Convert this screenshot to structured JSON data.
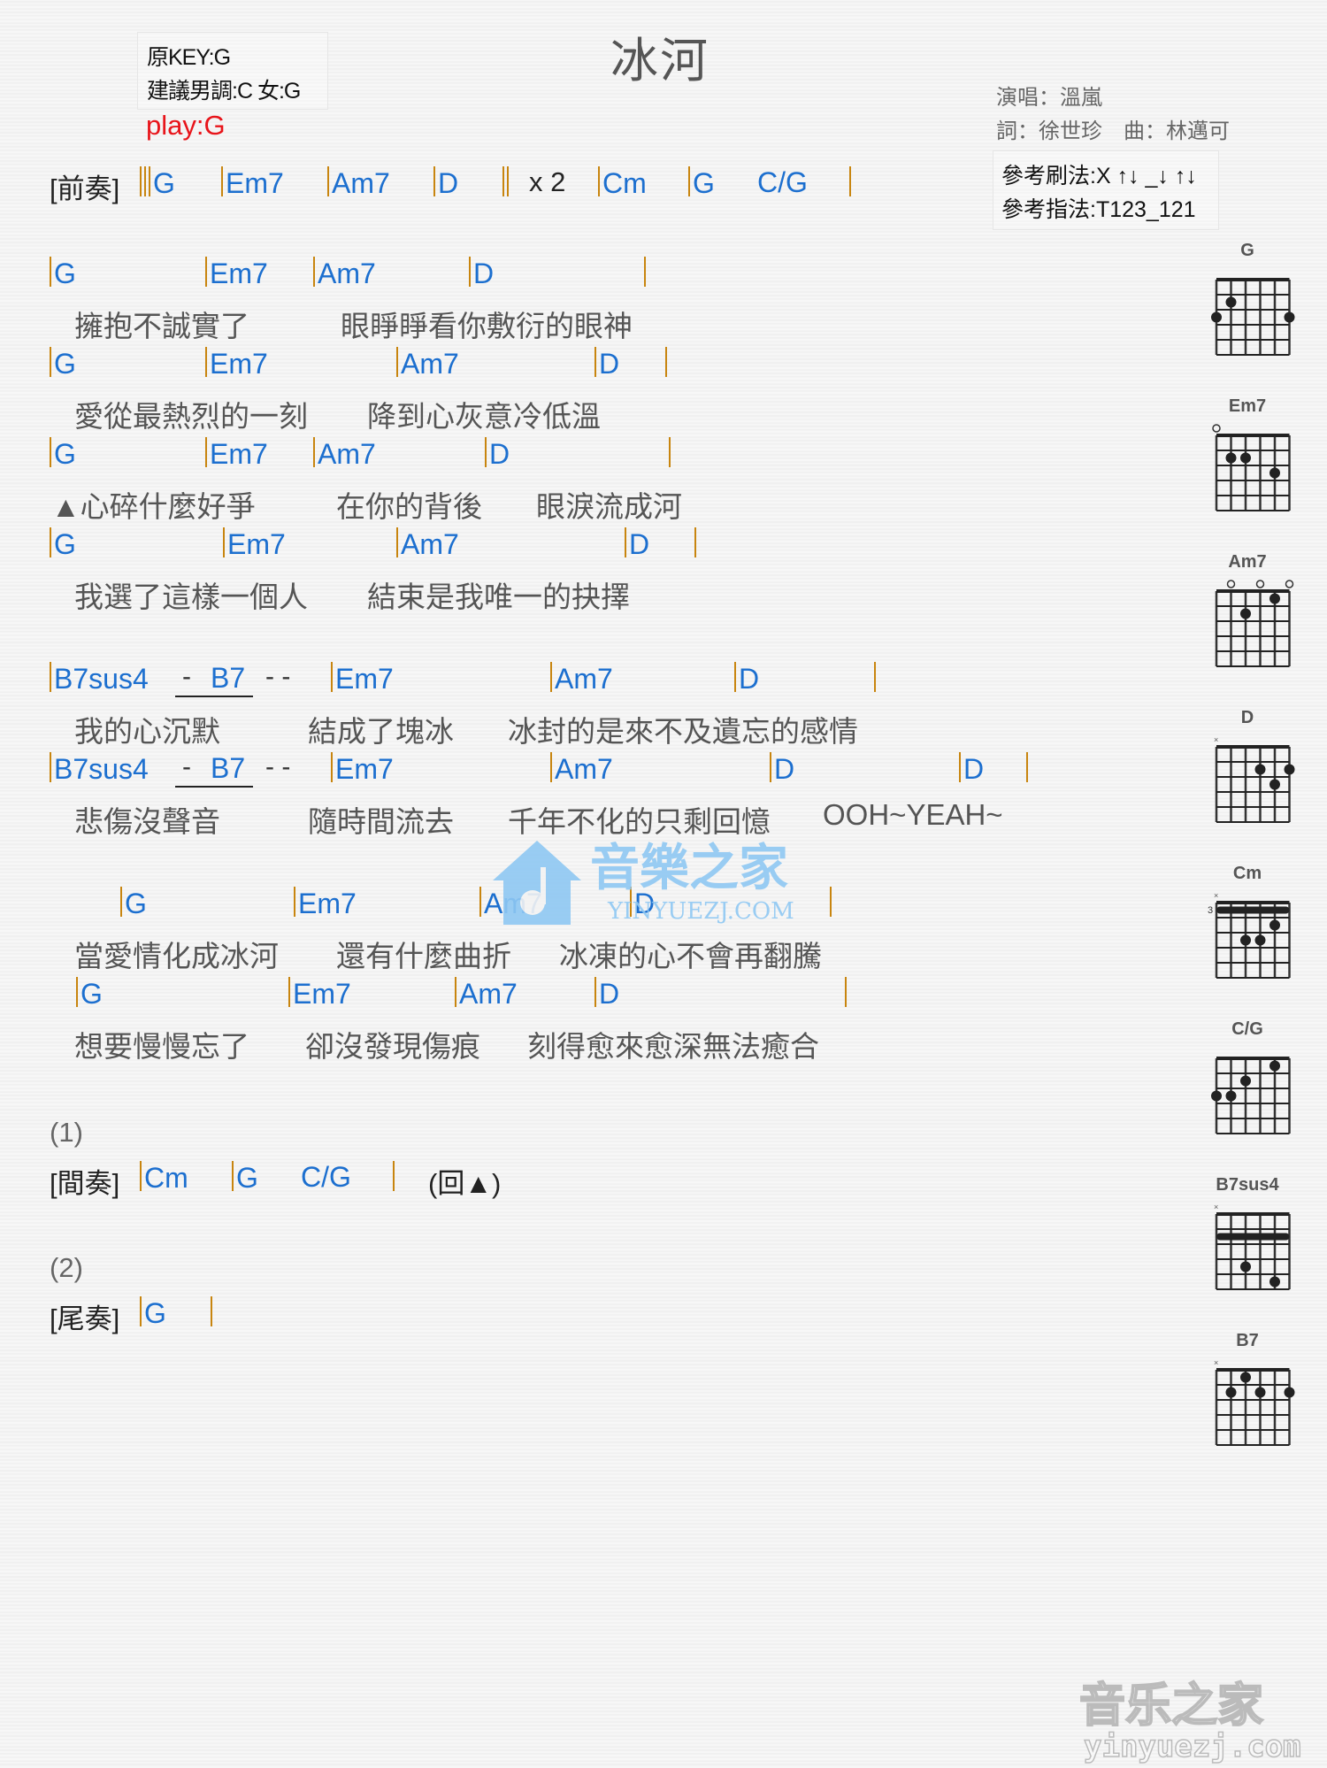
{
  "header": {
    "title": "冰河",
    "original_key": "原KEY:G",
    "suggested_key": "建議男調:C 女:G",
    "play_key": "play:G",
    "singer": "演唱：溫嵐",
    "credits": "詞：徐世珍　曲：林邁可",
    "strum_pattern": "參考刷法:X ↑↓ _↓ ↑↓",
    "finger_pattern": "參考指法:T123_121"
  },
  "intro": {
    "label": "[前奏]",
    "chords": [
      "G",
      "Em7",
      "Am7",
      "D",
      "Cm",
      "G",
      "C/G"
    ],
    "repeat": "x 2"
  },
  "verses": [
    {
      "chords": [
        "G",
        "Em7",
        "Am7",
        "D"
      ],
      "lyrics": [
        "擁抱不誠實了",
        "眼睜睜看你敷衍的眼神"
      ]
    },
    {
      "chords": [
        "G",
        "Em7",
        "Am7",
        "D"
      ],
      "lyrics": [
        "愛從最熱烈的一刻",
        "降到心灰意冷低溫"
      ]
    },
    {
      "chords": [
        "G",
        "Em7",
        "Am7",
        "D"
      ],
      "lyrics": [
        "▲心碎什麼好爭",
        "在你的背後",
        "眼淚流成河"
      ]
    },
    {
      "chords": [
        "G",
        "Em7",
        "Am7",
        "D"
      ],
      "lyrics": [
        "我選了這樣一個人",
        "結束是我唯一的抉擇"
      ]
    }
  ],
  "prechorus": [
    {
      "chords": [
        "B7sus4",
        "-",
        "B7",
        "- -",
        "Em7",
        "Am7",
        "D"
      ],
      "lyrics": [
        "我的心沉默",
        "結成了塊冰",
        "冰封的是來不及遺忘的感情"
      ]
    },
    {
      "chords": [
        "B7sus4",
        "-",
        "B7",
        "- -",
        "Em7",
        "Am7",
        "D",
        "D"
      ],
      "lyrics": [
        "悲傷沒聲音",
        "隨時間流去",
        "千年不化的只剩回憶",
        "OOH~YEAH~"
      ]
    }
  ],
  "chorus": [
    {
      "chords": [
        "G",
        "Em7",
        "Am7",
        "D"
      ],
      "lyrics": [
        "當愛情化成冰河",
        "還有什麼曲折",
        "冰凍的心不會再翻騰"
      ]
    },
    {
      "chords": [
        "G",
        "Em7",
        "Am7",
        "D"
      ],
      "lyrics": [
        "想要慢慢忘了",
        "卻沒發現傷痕",
        "刻得愈來愈深無法癒合"
      ]
    }
  ],
  "ending1": {
    "marker": "(1)",
    "label": "[間奏]",
    "chords": [
      "Cm",
      "G",
      "C/G"
    ],
    "return": "(回▲)"
  },
  "ending2": {
    "marker": "(2)",
    "label": "[尾奏]",
    "chords": [
      "G"
    ]
  },
  "chord_diagrams": [
    {
      "name": "G",
      "base_fret": "",
      "dots": [
        [
          5,
          2
        ],
        [
          6,
          3
        ],
        [
          1,
          3
        ]
      ],
      "open": [],
      "muted": [],
      "barre": null
    },
    {
      "name": "Em7",
      "base_fret": "",
      "dots": [
        [
          5,
          2
        ],
        [
          4,
          2
        ],
        [
          2,
          3
        ]
      ],
      "open": [
        6
      ],
      "muted": [],
      "barre": null
    },
    {
      "name": "Am7",
      "base_fret": "",
      "dots": [
        [
          2,
          1
        ],
        [
          4,
          2
        ]
      ],
      "open": [
        5,
        3,
        1
      ],
      "muted": [],
      "barre": null
    },
    {
      "name": "D",
      "base_fret": "",
      "dots": [
        [
          3,
          2
        ],
        [
          1,
          2
        ],
        [
          2,
          3
        ]
      ],
      "open": [],
      "muted": [
        6
      ],
      "barre": null
    },
    {
      "name": "Cm",
      "base_fret": "3",
      "dots": [
        [
          2,
          2
        ],
        [
          4,
          3
        ],
        [
          3,
          3
        ]
      ],
      "open": [],
      "muted": [
        6
      ],
      "barre": 1
    },
    {
      "name": "C/G",
      "base_fret": "",
      "dots": [
        [
          2,
          1
        ],
        [
          4,
          2
        ],
        [
          6,
          3
        ],
        [
          5,
          3
        ]
      ],
      "open": [],
      "muted": [],
      "barre": null
    },
    {
      "name": "B7sus4",
      "base_fret": "",
      "dots": [
        [
          4,
          4
        ],
        [
          2,
          5
        ]
      ],
      "open": [],
      "muted": [
        6
      ],
      "barre": 2
    },
    {
      "name": "B7",
      "base_fret": "",
      "dots": [
        [
          4,
          1
        ],
        [
          5,
          2
        ],
        [
          3,
          2
        ],
        [
          1,
          2
        ]
      ],
      "open": [],
      "muted": [
        6
      ],
      "barre": null
    }
  ],
  "watermark": {
    "center_cn": "音樂之家",
    "center_en": "YINYUEZJ.COM",
    "corner_cn": "音乐之家",
    "corner_en": "yinyuezj.com"
  },
  "colors": {
    "chord": "#1c6fcf",
    "barline": "#c8850f",
    "play_key": "#e8141a",
    "watermark": "#8fc8f3"
  }
}
